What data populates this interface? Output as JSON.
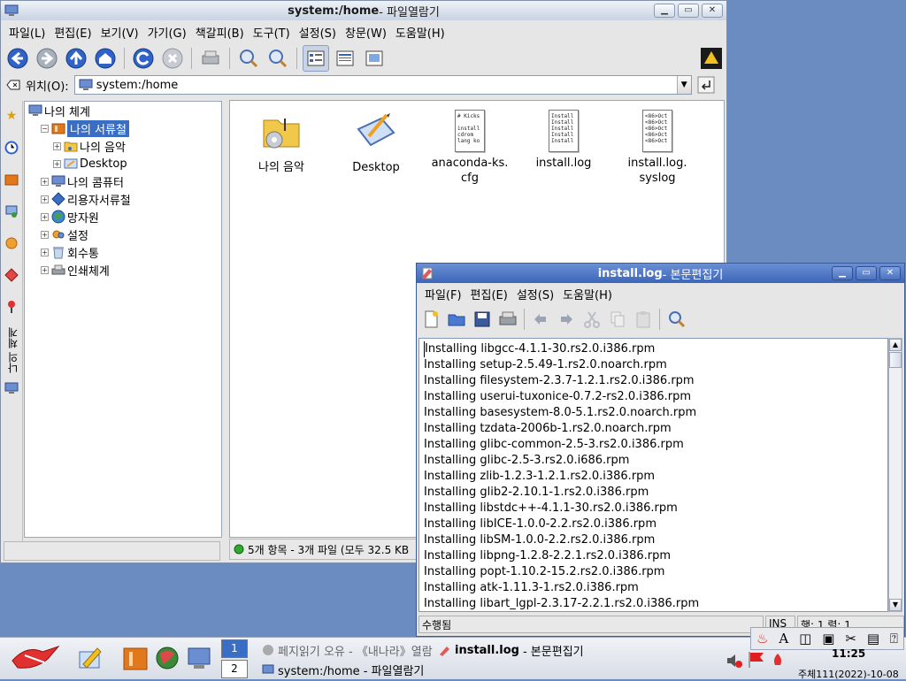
{
  "file_manager": {
    "title": "system:/home",
    "title_app": " - 파일열람기",
    "menu": [
      "파일(L)",
      "편집(E)",
      "보기(V)",
      "가기(G)",
      "책갈피(B)",
      "도구(T)",
      "설정(S)",
      "창문(W)",
      "도움말(H)"
    ],
    "location_label": "위치(O):",
    "location_value": "system:/home",
    "tree": [
      {
        "label": "나의 체계",
        "level": 0,
        "expander": "",
        "icon": "computer-icon",
        "selected": false
      },
      {
        "label": "나의 서류철",
        "level": 1,
        "expander": "−",
        "icon": "home-folder-icon",
        "selected": true
      },
      {
        "label": "나의 음악",
        "level": 2,
        "expander": "+",
        "icon": "music-folder-icon",
        "selected": false
      },
      {
        "label": "Desktop",
        "level": 2,
        "expander": "+",
        "icon": "desktop-icon",
        "selected": false
      },
      {
        "label": "나의 콤퓨터",
        "level": 1,
        "expander": "+",
        "icon": "computer-icon",
        "selected": false
      },
      {
        "label": "리용자서류철",
        "level": 1,
        "expander": "+",
        "icon": "users-folder-icon",
        "selected": false
      },
      {
        "label": "망자원",
        "level": 1,
        "expander": "+",
        "icon": "globe-icon",
        "selected": false
      },
      {
        "label": "설정",
        "level": 1,
        "expander": "+",
        "icon": "settings-icon",
        "selected": false
      },
      {
        "label": "회수통",
        "level": 1,
        "expander": "+",
        "icon": "trash-icon",
        "selected": false
      },
      {
        "label": "인쇄체계",
        "level": 1,
        "expander": "+",
        "icon": "printer-icon",
        "selected": false
      }
    ],
    "side_tab_label": "나의 체계",
    "files": [
      {
        "name": "나의 음악",
        "kind": "music-folder",
        "preview": ""
      },
      {
        "name": "Desktop",
        "kind": "desktop-folder",
        "preview": ""
      },
      {
        "name": "anaconda-ks.\ncfg",
        "kind": "text",
        "preview": "# Kicks\n\ninstall\ncdrom\nlang ko"
      },
      {
        "name": "install.log",
        "kind": "text",
        "preview": "Install\nInstall\nInstall\nInstall\nInstall"
      },
      {
        "name": "install.log.\nsyslog",
        "kind": "text",
        "preview": "<86>Oct\n<86>Oct\n<86>Oct\n<86>Oct\n<86>Oct"
      }
    ],
    "status": "5개 항목 - 3개 파일 (모두 32.5 KB"
  },
  "editor": {
    "title": "install.log",
    "title_app": " - 본문편집기",
    "menu": [
      "파일(F)",
      "편집(E)",
      "설정(S)",
      "도움말(H)"
    ],
    "lines": [
      "Installing libgcc-4.1.1-30.rs2.0.i386.rpm",
      "Installing setup-2.5.49-1.rs2.0.noarch.rpm",
      "Installing filesystem-2.3.7-1.2.1.rs2.0.i386.rpm",
      "Installing userui-tuxonice-0.7.2-rs2.0.i386.rpm",
      "Installing basesystem-8.0-5.1.rs2.0.noarch.rpm",
      "Installing tzdata-2006b-1.rs2.0.noarch.rpm",
      "Installing glibc-common-2.5-3.rs2.0.i386.rpm",
      "Installing glibc-2.5-3.rs2.0.i686.rpm",
      "Installing zlib-1.2.3-1.2.1.rs2.0.i386.rpm",
      "Installing glib2-2.10.1-1.rs2.0.i386.rpm",
      "Installing libstdc++-4.1.1-30.rs2.0.i386.rpm",
      "Installing libICE-1.0.0-2.2.rs2.0.i386.rpm",
      "Installing libSM-1.0.0-2.2.rs2.0.i386.rpm",
      "Installing libpng-1.2.8-2.2.1.rs2.0.i386.rpm",
      "Installing popt-1.10.2-15.2.rs2.0.i386.rpm",
      "Installing atk-1.11.3-1.rs2.0.i386.rpm",
      "Installing libart_lgpl-2.3.17-2.2.1.rs2.0.i386.rpm"
    ],
    "status_line": "수행됨",
    "status_mode": "INS",
    "status_pos": "행: 1 렬: 1"
  },
  "taskbar": {
    "pager": [
      "1",
      "2"
    ],
    "tasks": [
      {
        "icon": "globe-small-icon",
        "label": "페지읽기 오유 - 《내나라》열람",
        "bold_prefix": ""
      },
      {
        "icon": "editor-small-icon",
        "label": " - 본문편집기",
        "bold_prefix": "install.log"
      },
      {
        "icon": "filemanager-small-icon",
        "label": "system:/home - 파일열람기",
        "bold_prefix": ""
      }
    ],
    "clock": "11:25",
    "date": "주체111(2022)-10-08"
  }
}
